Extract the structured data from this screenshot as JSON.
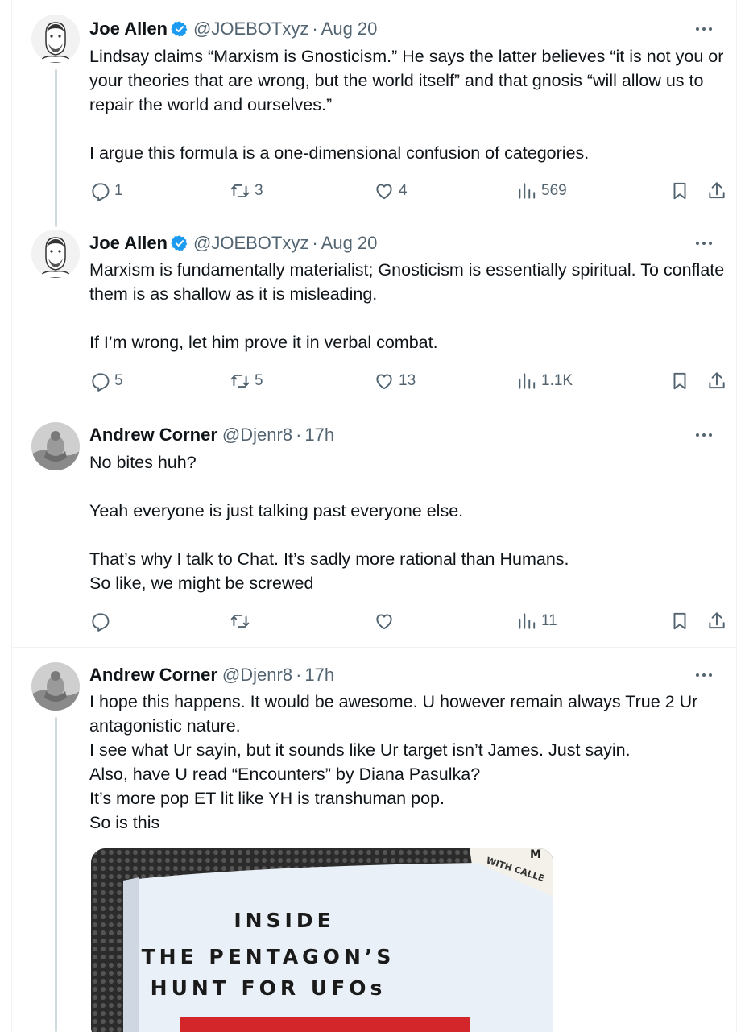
{
  "tweets": [
    {
      "author": "Joe Allen",
      "handle": "@JOEBOTxyz",
      "time": "Aug 20",
      "verified": true,
      "text": "Lindsay claims “Marxism is Gnosticism.” He says the latter believes “it is not you or your theories that are wrong, but the world itself” and that gnosis “will allow us to repair the world and ourselves.”\n\nI argue this formula is a one-dimensional confusion of categories.",
      "replies": "1",
      "reposts": "3",
      "likes": "4",
      "views": "569"
    },
    {
      "author": "Joe Allen",
      "handle": "@JOEBOTxyz",
      "time": "Aug 20",
      "verified": true,
      "text": "Marxism is fundamentally materialist; Gnosticism is essentially spiritual. To conflate them is as shallow as it is misleading.\n\nIf I’m wrong, let him prove it in verbal combat.",
      "replies": "5",
      "reposts": "5",
      "likes": "13",
      "views": "1.1K"
    },
    {
      "author": "Andrew Corner",
      "handle": "@Djenr8",
      "time": "17h",
      "verified": false,
      "text": "No bites huh?\n\nYeah everyone is just talking past everyone else.\n\nThat’s why I talk to Chat. It’s sadly more rational than Humans.\nSo like, we might be screwed",
      "replies": "",
      "reposts": "",
      "likes": "",
      "views": "11"
    },
    {
      "author": "Andrew Corner",
      "handle": "@Djenr8",
      "time": "17h",
      "verified": false,
      "text": "I hope this happens. It would be awesome. U however remain always True 2 Ur antagonistic nature.\nI see what Ur sayin, but it sounds like Ur target isn’t James. Just sayin.\nAlso, have U read “Encounters” by Diana Pasulka?\nIt’s more pop ET lit like YH is transhuman pop.\nSo is this",
      "media": {
        "book_line1": "INSIDE",
        "book_line2": "THE PENTAGON’S",
        "book_line3": "HUNT FOR UFOs",
        "corner_text": "WITH CALLE",
        "corner_letter": "M"
      }
    }
  ],
  "separator": "·",
  "colors": {
    "text": "#0f1419",
    "muted": "#536471",
    "border": "#eff3f4",
    "verified": "#1d9bf0",
    "thread": "#cfd9de"
  },
  "icons": [
    "reply-icon",
    "repost-icon",
    "like-icon",
    "views-icon",
    "bookmark-icon",
    "share-icon",
    "more-icon",
    "verified-badge-icon"
  ]
}
